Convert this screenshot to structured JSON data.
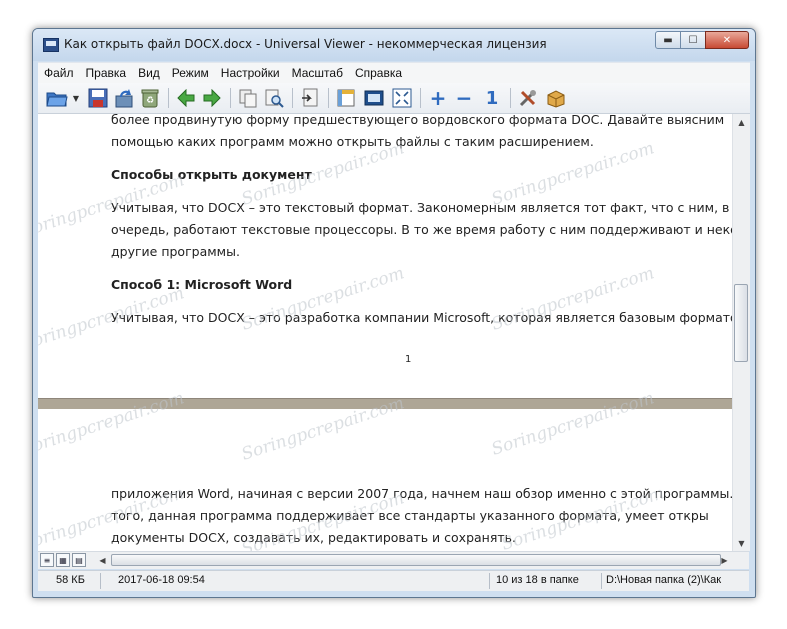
{
  "window": {
    "title": "Как открыть файл DOCX.docx - Universal Viewer - некоммерческая лицензия",
    "min_label": "▬",
    "max_label": "☐",
    "close_label": "✕"
  },
  "menu": [
    "Файл",
    "Правка",
    "Вид",
    "Режим",
    "Настройки",
    "Масштаб",
    "Справка"
  ],
  "toolbar": {
    "icons": [
      "open-folder-icon",
      "dropdown-arrow-icon",
      "save-icon",
      "reload-icon",
      "recycle-icon",
      "back-arrow-icon",
      "forward-arrow-icon",
      "copy-icon",
      "find-icon",
      "goto-icon",
      "toggle-panel-icon",
      "fullscreen-window-icon",
      "fit-page-icon",
      "zoom-in-icon",
      "zoom-out-icon",
      "zoom-actual-icon",
      "options-icon",
      "package-icon"
    ],
    "zoom_in": "+",
    "zoom_out": "−",
    "zoom_actual": "1"
  },
  "document": {
    "page1": [
      "более продвинутую форму предшествующего вордовского формата DOC. Давайте выясним",
      "помощью каких программ можно открыть файлы с таким расширением."
    ],
    "heading1": "Способы открыть документ",
    "para2": [
      "Учитывая, что DOCX – это текстовый формат. Закономерным является тот факт, что с ним, в пер",
      "очередь, работают текстовые процессоры. В то же время работу с ним поддерживают и некото",
      "другие программы."
    ],
    "heading2": "Способ 1: Microsoft Word",
    "para3": "Учитывая, что DOCX – это разработка компании Microsoft, которая является базовым форматом",
    "page_number": "1",
    "page2": [
      "приложения Word, начиная с версии 2007 года, начнем наш обзор именно с этой программы. Кр",
      "того, данная программа поддерживает все стандарты указанного формата, умеет откры",
      "документы DOCX, создавать их, редактировать и сохранять."
    ]
  },
  "watermark": "Soringpcrepair.com",
  "statusbar": {
    "size": "58 КБ",
    "date": "2017-06-18 09:54",
    "position": "10 из 18 в папке",
    "path": "D:\\Новая папка (2)\\Как"
  }
}
